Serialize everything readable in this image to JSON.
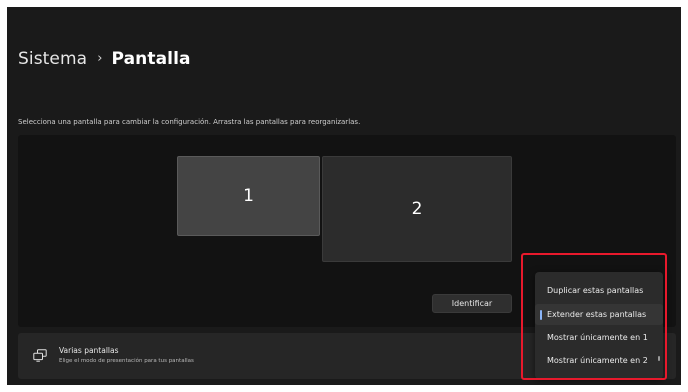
{
  "breadcrumb": {
    "root": "Sistema",
    "separator": "›",
    "current": "Pantalla"
  },
  "instructions": "Selecciona una pantalla para cambiar la configuración. Arrastra las pantallas para reorganizarlas.",
  "displays": [
    {
      "label": "1",
      "selected": true
    },
    {
      "label": "2",
      "selected": false
    }
  ],
  "identify_button": "Identificar",
  "multiple_displays": {
    "icon": "multiple-displays-icon",
    "title": "Varias pantallas",
    "subtitle": "Elige el modo de presentación para tus pantallas"
  },
  "projection_menu": {
    "items": [
      {
        "label": "Duplicar estas pantallas",
        "selected": false
      },
      {
        "label": "Extender estas pantallas",
        "selected": true
      },
      {
        "label": "Mostrar únicamente en 1",
        "selected": false
      },
      {
        "label": "Mostrar únicamente en 2",
        "selected": false
      }
    ]
  },
  "colors": {
    "background": "#1a1a1a",
    "panel": "#121212",
    "accent": "#8ab4f8",
    "highlight": "#e8192c"
  }
}
